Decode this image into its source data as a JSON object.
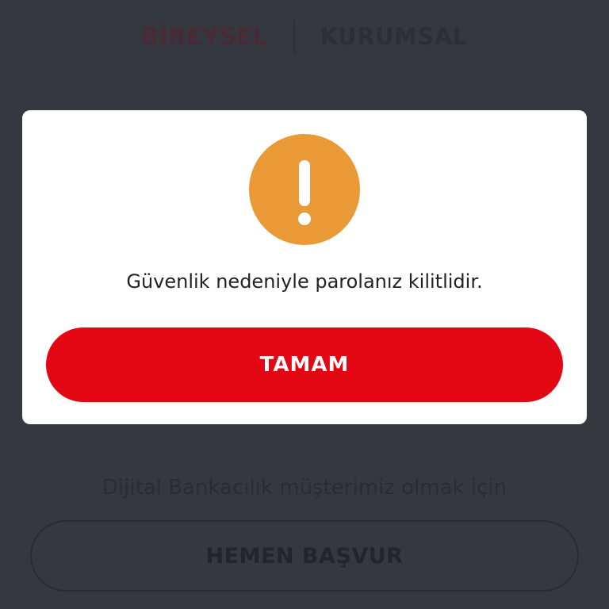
{
  "tabs": {
    "individual": "BİREYSEL",
    "corporate": "KURUMSAL"
  },
  "footer": {
    "join_text": "Dijital Bankacılık müşterimiz olmak için",
    "apply_label": "HEMEN BAŞVUR"
  },
  "dialog": {
    "icon": "exclamation-icon",
    "icon_color": "#e99a36",
    "message": "Güvenlik nedeniyle parolanız kilitlidir.",
    "ok_label": "TAMAM",
    "ok_color": "#e30613"
  }
}
